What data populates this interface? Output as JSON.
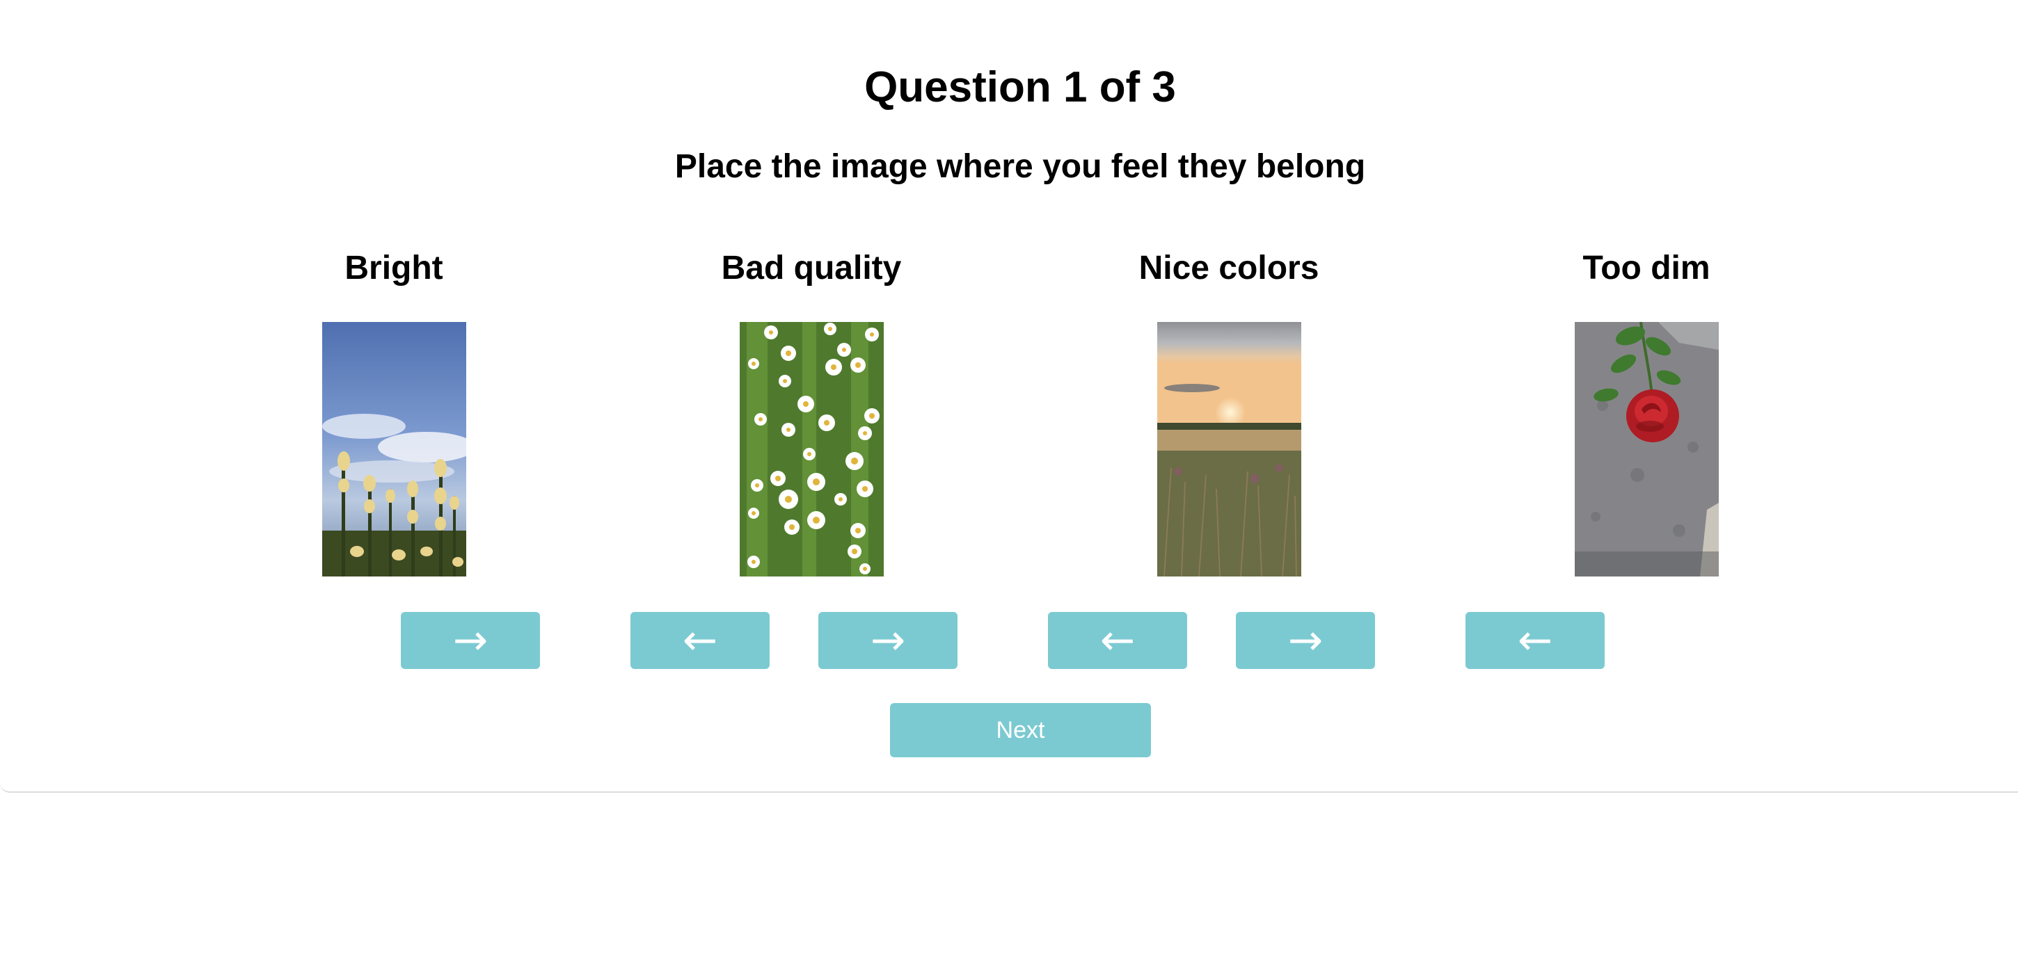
{
  "question": {
    "title": "Question 1 of 3",
    "instruction": "Place the image where you feel they belong"
  },
  "categories": [
    {
      "label": "Bright",
      "image": "flowers-against-blue-sky"
    },
    {
      "label": "Bad quality",
      "image": "white-daisies-in-grass"
    },
    {
      "label": "Nice colors",
      "image": "sunset-over-meadow"
    },
    {
      "label": "Too dim",
      "image": "red-rose-on-stone"
    }
  ],
  "buttons": {
    "left_arrow": "←",
    "right_arrow": "→",
    "next": "Next"
  },
  "colors": {
    "button": "#7bcad2",
    "button_text": "#ffffff",
    "text": "#000000"
  }
}
